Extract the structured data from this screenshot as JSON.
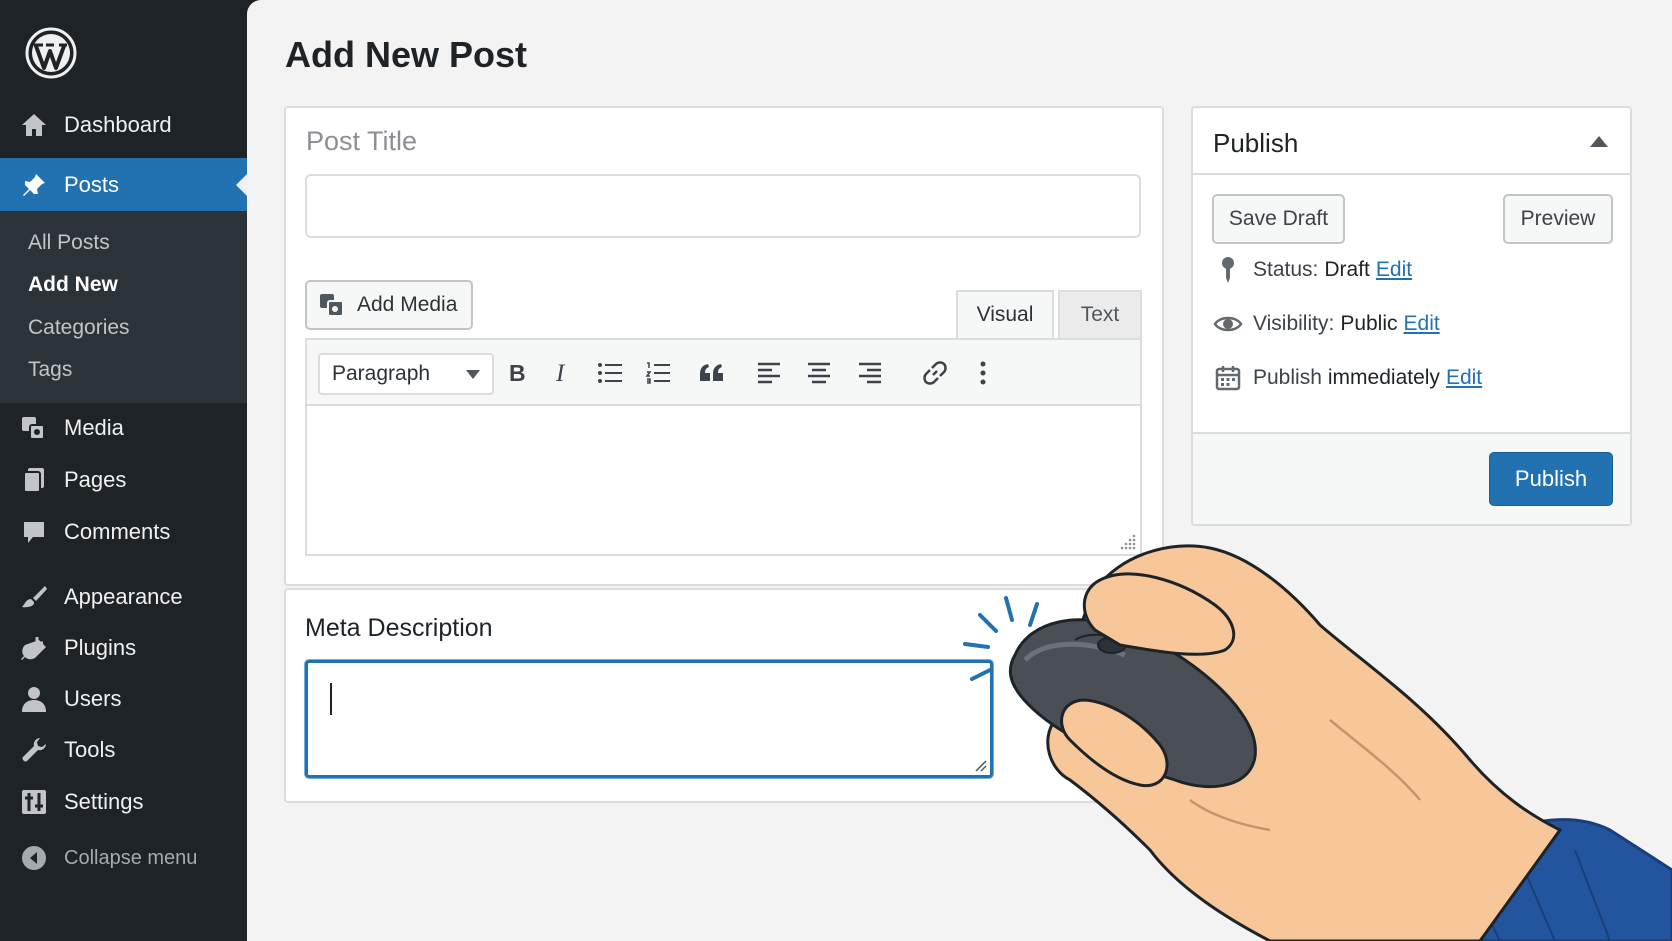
{
  "sidebar": {
    "logo_icon": "wordpress-logo-icon",
    "items": [
      {
        "label": "Dashboard",
        "icon": "dashboard-icon"
      },
      {
        "label": "Posts",
        "icon": "pin-icon",
        "active": true
      },
      {
        "label": "Media",
        "icon": "media-icon"
      },
      {
        "label": "Pages",
        "icon": "pages-icon"
      },
      {
        "label": "Comments",
        "icon": "comments-icon"
      },
      {
        "label": "Appearance",
        "icon": "brush-icon"
      },
      {
        "label": "Plugins",
        "icon": "plugin-icon"
      },
      {
        "label": "Users",
        "icon": "user-icon"
      },
      {
        "label": "Tools",
        "icon": "wrench-icon"
      },
      {
        "label": "Settings",
        "icon": "settings-icon"
      }
    ],
    "submenu": [
      {
        "label": "All Posts"
      },
      {
        "label": "Add New",
        "current": true
      },
      {
        "label": "Categories"
      },
      {
        "label": "Tags"
      }
    ],
    "collapse_label": "Collapse menu"
  },
  "page": {
    "title": "Add New Post"
  },
  "editor": {
    "title_placeholder": "Post Title",
    "title_value": "",
    "add_media_label": "Add Media",
    "tabs": [
      {
        "label": "Visual",
        "active": true
      },
      {
        "label": "Text"
      }
    ],
    "format_select_value": "Paragraph",
    "toolbar_icons": [
      "bold-icon",
      "italic-icon",
      "bulleted-list-icon",
      "numbered-list-icon",
      "blockquote-icon",
      "align-left-icon",
      "align-center-icon",
      "align-right-icon",
      "link-icon",
      "more-options-icon"
    ],
    "content_value": ""
  },
  "meta": {
    "label": "Meta Description",
    "value": ""
  },
  "publish": {
    "title": "Publish",
    "save_draft_label": "Save Draft",
    "preview_label": "Preview",
    "status_label": "Status:",
    "status_value": "Draft",
    "visibility_label": "Visibility:",
    "visibility_value": "Public",
    "schedule_label": "Publish",
    "schedule_value": "immediately",
    "edit_link": "Edit",
    "publish_button": "Publish"
  },
  "colors": {
    "sidebar_bg": "#1d2327",
    "accent": "#2271b1",
    "main_bg": "#f3f3f4"
  }
}
